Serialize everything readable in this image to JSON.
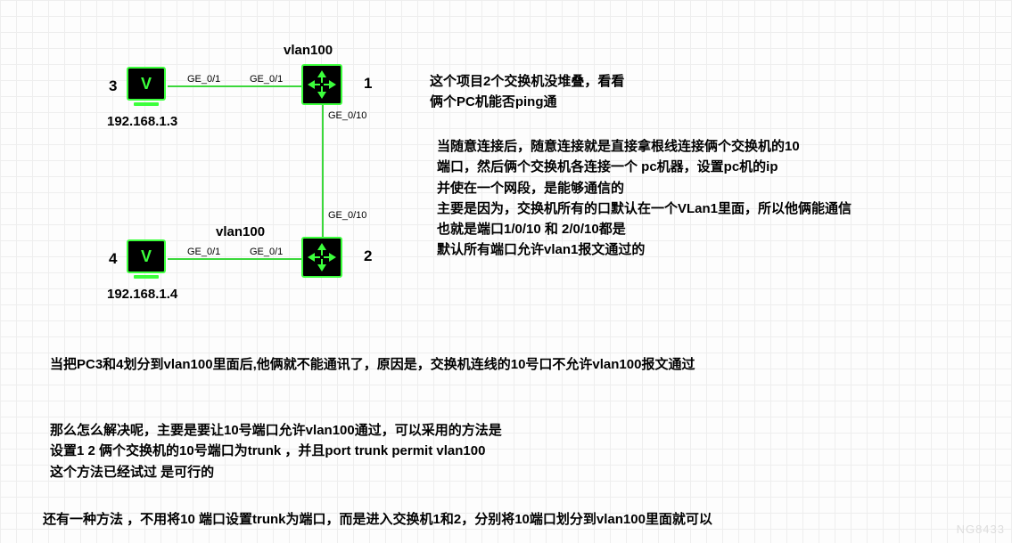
{
  "nodes": {
    "pc3": {
      "number": "3",
      "ip": "192.168.1.3",
      "port_label": "GE_0/1",
      "icon_letter": "V"
    },
    "pc4": {
      "number": "4",
      "ip": "192.168.1.4",
      "port_label": "GE_0/1",
      "icon_letter": "V"
    },
    "sw1": {
      "number": "1",
      "vlan_label": "vlan100",
      "port_left": "GE_0/1",
      "port_down": "GE_0/10"
    },
    "sw2": {
      "number": "2",
      "vlan_label": "vlan100",
      "port_left": "GE_0/1",
      "port_up": "GE_0/10"
    }
  },
  "text": {
    "intro_l1": "这个项目2个交换机没堆叠，看看",
    "intro_l2": "俩个PC机能否ping通",
    "para1_l1": "当随意连接后，随意连接就是直接拿根线连接俩个交换机的10",
    "para1_l2": "端口，然后俩个交换机各连接一个    pc机器，设置pc机的ip",
    "para1_l3": "并使在一个网段，是能够通信的",
    "para1_l4": "主要是因为，交换机所有的口默认在一个VLan1里面，所以他俩能通信",
    "para1_l5": "也就是端口1/0/10   和  2/0/10都是",
    "para1_l6": "默认所有端口允许vlan1报文通过的",
    "para2": "当把PC3和4划分到vlan100里面后,他俩就不能通讯了，原因是，交换机连线的10号口不允许vlan100报文通过",
    "para3_l1": "那么怎么解决呢，主要是要让10号端口允许vlan100通过，可以采用的方法是",
    "para3_l2": "设置1  2 俩个交换机的10号端口为trunk  ，并且port trunk permit vlan100",
    "para3_l3": "这个方法已经试过  是可行的",
    "para4": "还有一种方法  ，不用将10 端口设置trunk为端口，而是进入交换机1和2，分别将10端口划分到vlan100里面就可以"
  },
  "watermark": "NG8433"
}
